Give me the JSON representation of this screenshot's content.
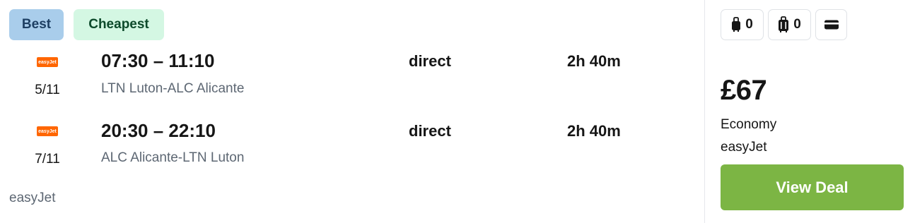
{
  "tags": {
    "best": "Best",
    "cheapest": "Cheapest"
  },
  "legs": [
    {
      "logo_text": "easyJet",
      "date": "5/11",
      "times": "07:30 – 11:10",
      "route": "LTN Luton-ALC Alicante",
      "stops": "direct",
      "duration": "2h 40m"
    },
    {
      "logo_text": "easyJet",
      "date": "7/11",
      "times": "20:30 – 22:10",
      "route": "ALC Alicante-LTN Luton",
      "stops": "direct",
      "duration": "2h 40m"
    }
  ],
  "airline": "easyJet",
  "fees": {
    "carry_on": {
      "icon": "carry-on-bag-icon",
      "count": "0"
    },
    "checked": {
      "icon": "checked-bag-icon",
      "count": "0"
    },
    "card": {
      "icon": "credit-card-icon"
    }
  },
  "price": {
    "amount": "£67",
    "cabin": "Economy",
    "provider": "easyJet",
    "cta": "View Deal"
  },
  "colors": {
    "best_tag": "#a9cdeb",
    "cheapest_tag": "#d4f7e3",
    "deal_button": "#7cb544",
    "easyjet_brand": "#ff6600"
  }
}
